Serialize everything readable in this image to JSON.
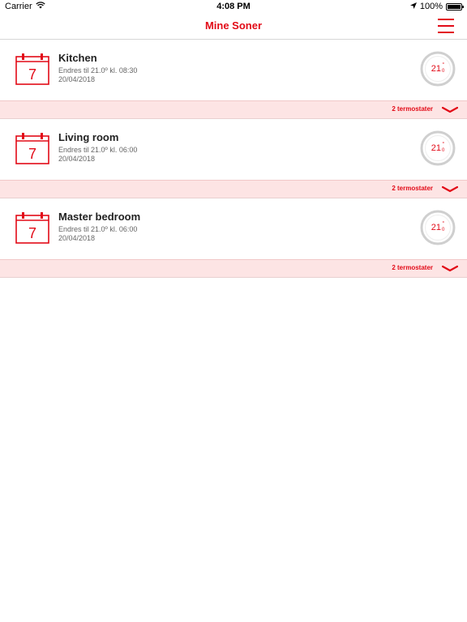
{
  "status_bar": {
    "carrier": "Carrier",
    "time": "4:08 PM",
    "battery": "100%"
  },
  "nav": {
    "title": "Mine Soner"
  },
  "zones": [
    {
      "name": "Kitchen",
      "schedule_day": "7",
      "change_text": "Endres til 21.0º kl. 08:30",
      "date": "20/04/2018",
      "temp_int": "21",
      "temp_dec": "0",
      "thermostats_label": "2 termostater"
    },
    {
      "name": "Living room",
      "schedule_day": "7",
      "change_text": "Endres til 21.0º kl. 06:00",
      "date": "20/04/2018",
      "temp_int": "21",
      "temp_dec": "0",
      "thermostats_label": "2 termostater"
    },
    {
      "name": "Master bedroom",
      "schedule_day": "7",
      "change_text": "Endres til 21.0º kl. 06:00",
      "date": "20/04/2018",
      "temp_int": "21",
      "temp_dec": "0",
      "thermostats_label": "2 termostater"
    }
  ],
  "colors": {
    "accent": "#e20a17",
    "subbar_bg": "#fde4e4"
  },
  "icons": {
    "menu": "hamburger-menu-icon",
    "calendar": "calendar-icon",
    "thermostat": "thermostat-dial-icon",
    "expand": "chevron-down-icon",
    "wifi": "wifi-icon",
    "location": "location-arrow-icon",
    "battery": "battery-icon"
  }
}
